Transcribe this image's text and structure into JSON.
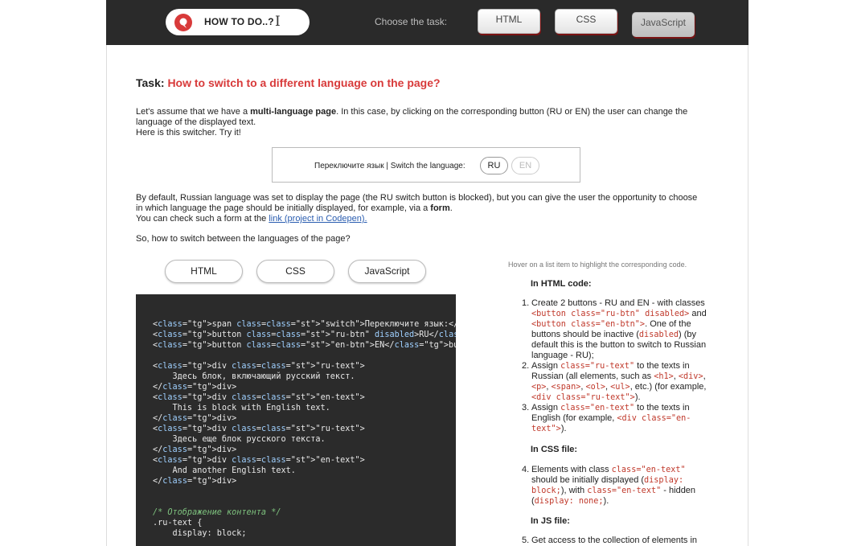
{
  "header": {
    "logo_text": "HOW TO DO..?",
    "cursor_glyph": "I",
    "choose_label": "Choose the task:",
    "task_buttons": [
      "HTML",
      "CSS",
      "JavaScript"
    ],
    "active_task": "JavaScript",
    "accent_color": "#d83a3a"
  },
  "task": {
    "prefix": "Task:",
    "question": "How to switch to a different language on the page?"
  },
  "intro": {
    "p1_a": "Let's assume that we have a ",
    "p1_bold": "multi-language page",
    "p1_b": ". In this case, by clicking on the corresponding button (RU or EN) the user can change the",
    "p1_c": "language of the displayed text.",
    "p1_d": "Here is this switcher. Try it!"
  },
  "demo": {
    "label": "Переключите язык | Switch the language:",
    "ru": "RU",
    "en": "EN"
  },
  "details": {
    "line1": "By default, Russian language was set to display the page (the RU switch button is blocked), but you can give the user the opportunity to choose",
    "line2_a": "in which language the page should be initially displayed, for example, via a ",
    "line2_bold": "form",
    "line2_b": ".",
    "line3_a": "You can check such a form at the ",
    "link_text": "link (project in Codepen).",
    "question": "So, how to switch between the languages of the page?"
  },
  "code_tabs": [
    "HTML",
    "CSS",
    "JavaScript"
  ],
  "code_lines": [
    "<span class=\"switch\">Переключите язык:</span>",
    "<button class=\"ru-btn\" disabled>RU</button>",
    "<button class=\"en-btn\">EN</button>",
    "",
    "<div class=\"ru-text\">",
    "    Здесь блок, включающий русский текст.",
    "</div>",
    "<div class=\"en-text\">",
    "    This is block with English text.",
    "</div>",
    "<div class=\"ru-text\">",
    "    Здесь еще блок русского текста.",
    "</div>",
    "<div class=\"en-text\">",
    "    And another English text.",
    "</div>",
    "",
    "",
    "/* Отображение контента */",
    ".ru-text {",
    "    display: block;"
  ],
  "explanation": {
    "hint": "Hover on a list item to highlight the corresponding code.",
    "html_head": "In HTML code:",
    "css_head": "In CSS file:",
    "js_head": "In JS file:",
    "step1": "1. Create 2 buttons - RU and EN - with classes <button class=\"ru-btn\" disabled> and <button class=\"en-btn\">. One of the buttons should be inactive (disabled) (by default this is the button to switch to Russian language - RU);",
    "step2": "2. Assign class=\"ru-text\" to the texts in Russian (all elements, such as <h1>, <div>, <p>, <span>, <ol>, <ul>, etc.) (for example, <div class=\"ru-text\">).",
    "step3": "3. Assign class=\"en-text\" to the texts in English (for example, <div class=\"en-text\">).",
    "step4": "4. Elements with class class=\"en-text\" should be initially displayed (display: block;), with class=\"en-text\" - hidden (display: none;).",
    "step5": "5. Get access to the collection of elements in"
  }
}
